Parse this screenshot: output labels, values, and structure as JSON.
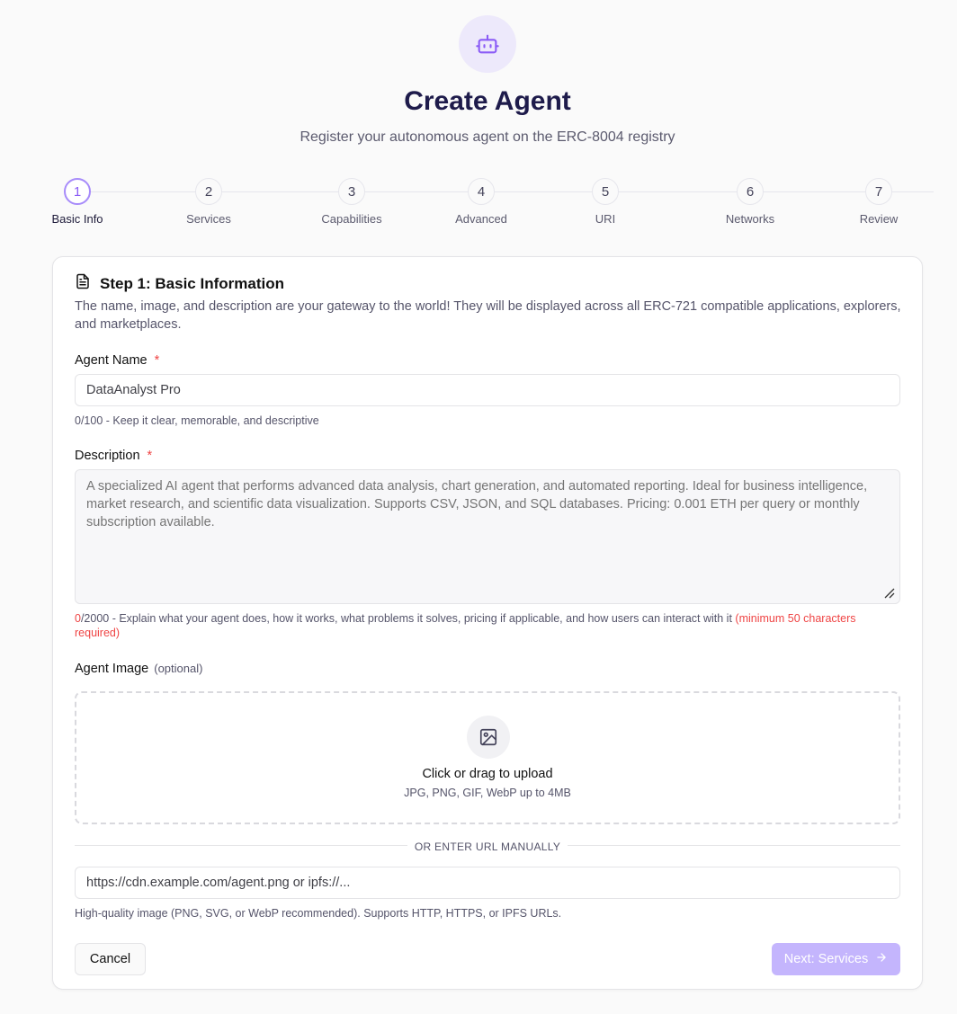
{
  "header": {
    "icon": "bot-icon",
    "title": "Create Agent",
    "subtitle": "Register your autonomous agent on the ERC-8004 registry"
  },
  "stepper": {
    "active_index": 0,
    "steps": [
      {
        "number": "1",
        "label": "Basic Info"
      },
      {
        "number": "2",
        "label": "Services"
      },
      {
        "number": "3",
        "label": "Capabilities"
      },
      {
        "number": "4",
        "label": "Advanced"
      },
      {
        "number": "5",
        "label": "URI"
      },
      {
        "number": "6",
        "label": "Networks"
      },
      {
        "number": "7",
        "label": "Review"
      }
    ]
  },
  "form": {
    "section_icon": "file-text-icon",
    "section_title": "Step 1: Basic Information",
    "section_desc": "The name, image, and description are your gateway to the world! They will be displayed across all ERC-721 compatible applications, explorers, and marketplaces.",
    "name": {
      "label": "Agent Name",
      "required": "*",
      "placeholder": "DataAnalyst Pro",
      "hint": "0/100 - Keep it clear, memorable, and descriptive"
    },
    "description": {
      "label": "Description",
      "required": "*",
      "placeholder": "A specialized AI agent that performs advanced data analysis, chart generation, and automated reporting. Ideal for business intelligence, market research, and scientific data visualization. Supports CSV, JSON, and SQL databases. Pricing: 0.001 ETH per query or monthly subscription available.",
      "hint_count": "0",
      "hint_text": "/2000 - Explain what your agent does, how it works, what problems it solves, pricing if applicable, and how users can interact with it",
      "hint_warning": "(minimum 50 characters required)"
    },
    "image": {
      "label": "Agent Image",
      "optional": "(optional)",
      "upload_icon": "image-icon",
      "upload_title": "Click or drag to upload",
      "upload_sub": "JPG, PNG, GIF, WebP up to 4MB",
      "divider": "OR ENTER URL MANUALLY",
      "url_placeholder": "https://cdn.example.com/agent.png or ipfs://...",
      "url_hint": "High-quality image (PNG, SVG, or WebP recommended). Supports HTTP, HTTPS, or IPFS URLs."
    },
    "actions": {
      "cancel": "Cancel",
      "next": "Next: Services",
      "next_icon": "arrow-right-icon"
    }
  },
  "colors": {
    "accent": "#8b5cf6",
    "accent_light": "#c4b5fd",
    "error": "#ef4444"
  }
}
